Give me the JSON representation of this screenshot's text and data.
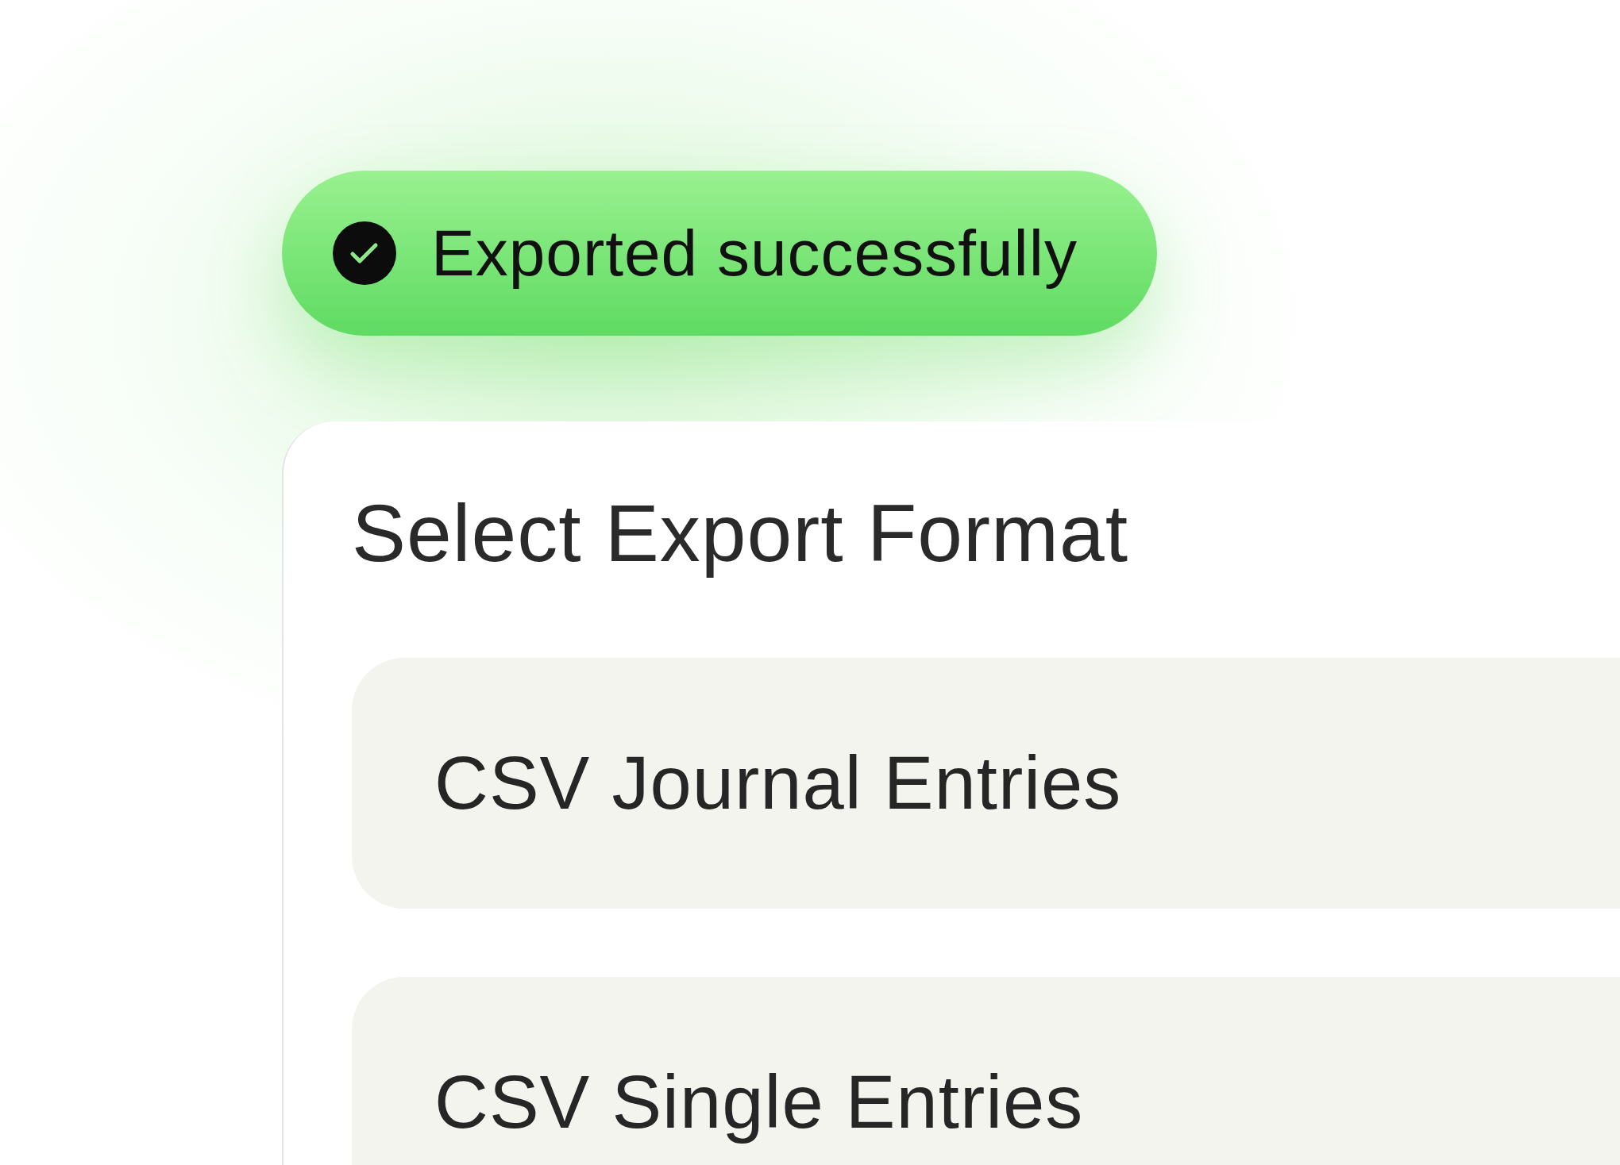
{
  "toast": {
    "message": "Exported successfully"
  },
  "dialog": {
    "title": "Select Export Format",
    "options": [
      {
        "label": "CSV Journal Entries"
      },
      {
        "label": "CSV Single Entries"
      }
    ]
  }
}
